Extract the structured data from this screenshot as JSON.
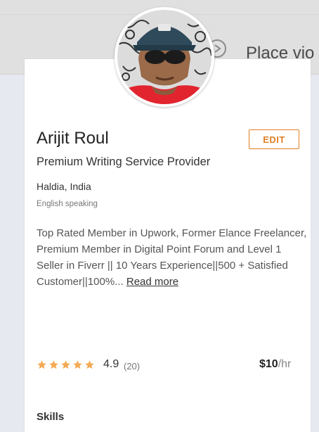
{
  "background": {
    "partial_text": "Place vio"
  },
  "profile": {
    "name": "Arijit Roul",
    "edit_label": "EDIT",
    "headline": "Premium Writing Service Provider",
    "location": "Haldia, India",
    "language": "English speaking",
    "bio": "Top Rated Member in Upwork, Former Elance Freelancer, Premium Member in Digital Point Forum and Level 1 Seller in Fiverr || 10 Years Experience||500 + Satisfied Customer||100%...",
    "read_more": "Read more",
    "rating": "4.9",
    "review_count": "(20)",
    "stars": 5,
    "rate_amount": "$10",
    "rate_unit": "/hr",
    "next_section_partial": "Skills"
  },
  "colors": {
    "accent": "#e07f22",
    "star": "#f4a953"
  }
}
